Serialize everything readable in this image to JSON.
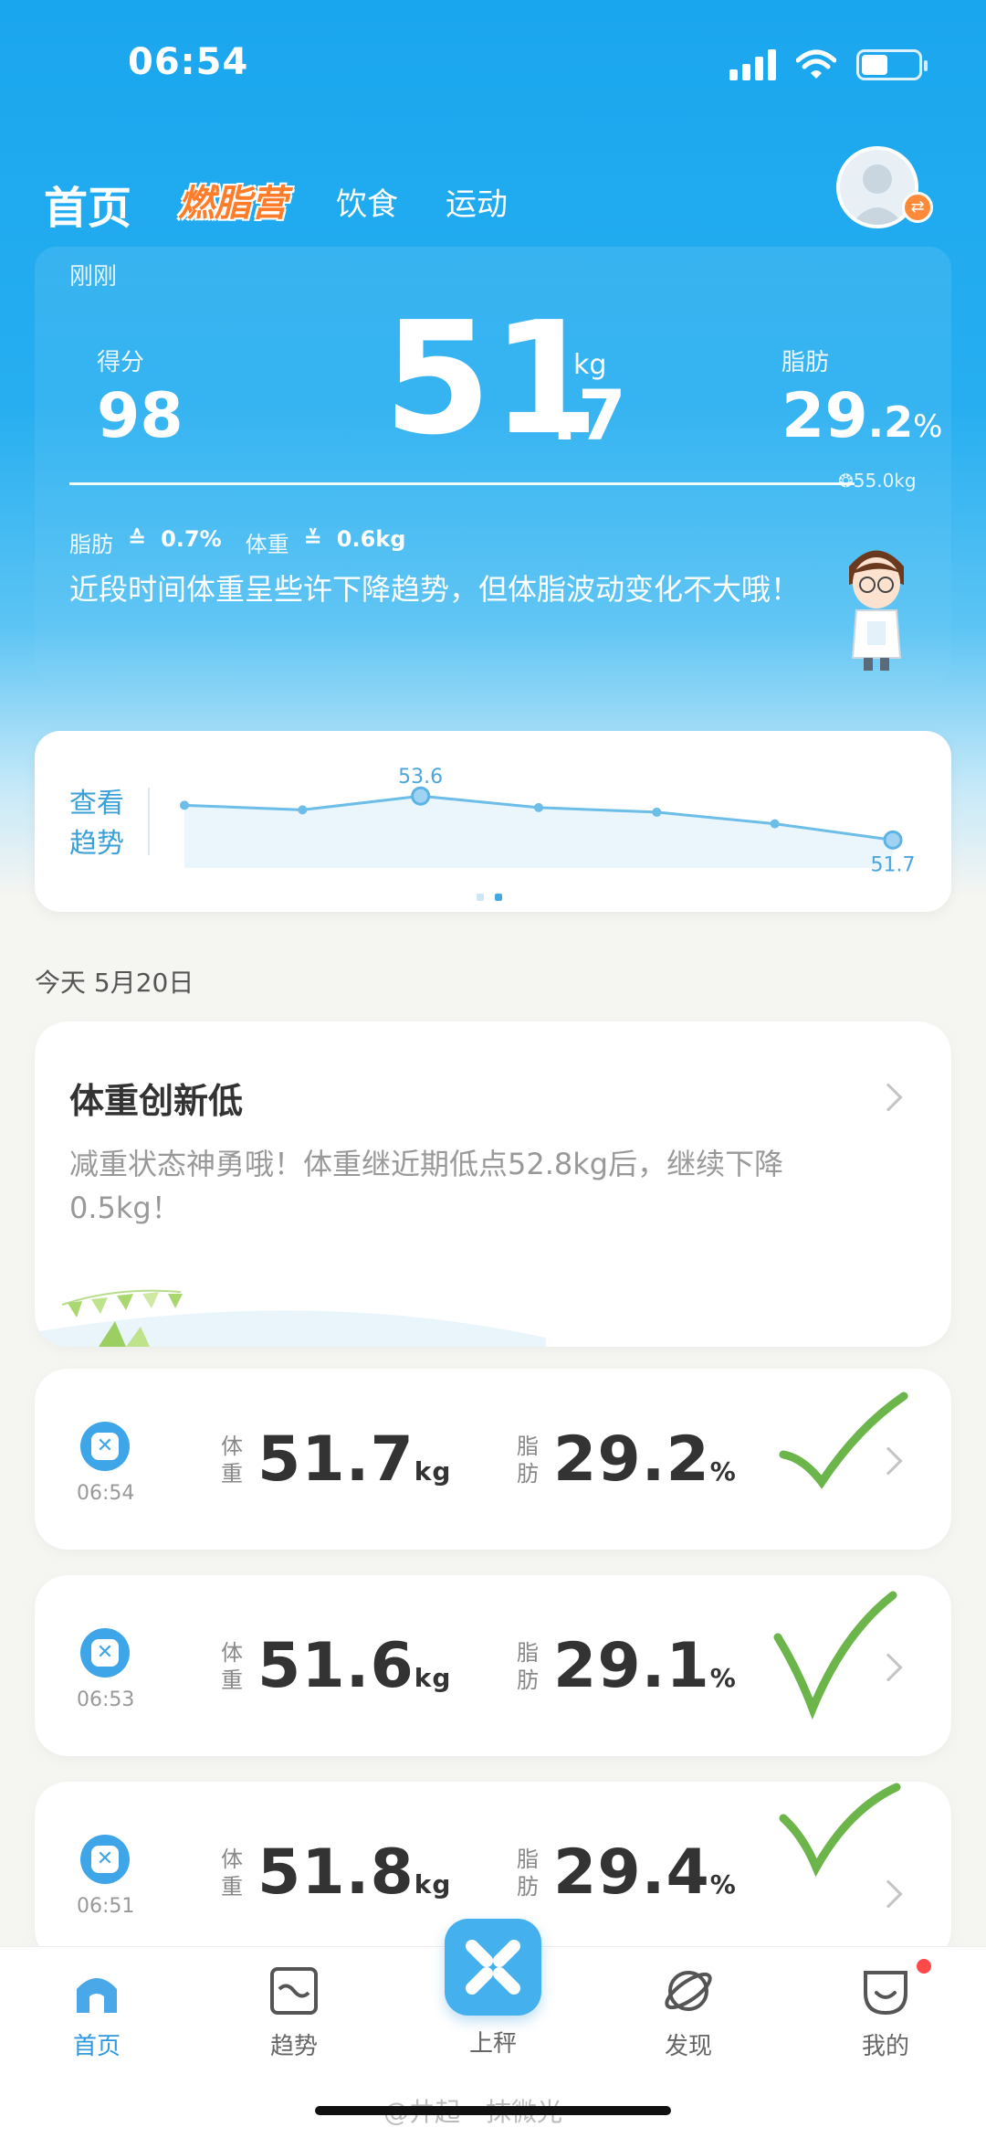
{
  "status_bar": {
    "time": "06:54",
    "icons": [
      "signal-icon",
      "wifi-icon",
      "battery-icon"
    ]
  },
  "header": {
    "tabs": [
      {
        "label": "首页",
        "active": true
      },
      {
        "label": "燃脂营",
        "highlight": "#ff7d2a"
      },
      {
        "label": "饮食"
      },
      {
        "label": "运动"
      }
    ],
    "avatar_icon": "user-avatar-icon",
    "avatar_badge": "⇄"
  },
  "hero": {
    "time_label": "刚刚",
    "score_label": "得分",
    "score_value": "98",
    "weight_int": "51",
    "weight_dec": ".7",
    "weight_unit": "kg",
    "fat_label": "脂肪",
    "fat_int": "29",
    "fat_dec": ".2",
    "fat_unit": "%",
    "goal": "55.0kg",
    "fat_delta_label": "脂肪",
    "fat_delta_value": "0.7%",
    "weight_delta_label": "体重",
    "weight_delta_value": "0.6kg",
    "advice": "近段时间体重呈些许下降趋势，但体脂波动变化不大哦！"
  },
  "trend": {
    "label_line1": "查看",
    "label_line2": "趋势",
    "chart_data": {
      "type": "line",
      "values": [
        53.2,
        53.0,
        53.6,
        53.1,
        52.9,
        52.4,
        51.7
      ],
      "labeled": [
        {
          "index": 2,
          "label": "53.6"
        },
        {
          "index": 6,
          "label": "51.7"
        }
      ]
    },
    "page_dots": 2,
    "active_dot": 1
  },
  "date_line": "今天 5月20日",
  "milestone": {
    "title": "体重创新低",
    "desc": "减重状态神勇哦！体重继近期低点52.8kg后，继续下降0.5kg！"
  },
  "records_labels": {
    "weight_line1": "体",
    "weight_line2": "重",
    "fat_line1": "脂",
    "fat_line2": "肪",
    "weight_unit": "kg",
    "fat_unit": "%"
  },
  "records": [
    {
      "time": "06:54",
      "weight": "51.7",
      "fat": "29.2"
    },
    {
      "time": "06:53",
      "weight": "51.6",
      "fat": "29.1"
    },
    {
      "time": "06:51",
      "weight": "51.8",
      "fat": "29.4"
    }
  ],
  "bottom_nav": {
    "items": [
      {
        "label": "首页",
        "icon": "home-icon",
        "active": true
      },
      {
        "label": "趋势",
        "icon": "trend-icon"
      },
      {
        "label": "上秤",
        "icon": "scale-icon"
      },
      {
        "label": "发现",
        "icon": "planet-icon"
      },
      {
        "label": "我的",
        "icon": "profile-icon",
        "badge": true
      }
    ]
  },
  "watermark": "@井起一抹微光",
  "colors": {
    "primary": "#1aa6ee",
    "accent": "#ff7d2a",
    "check": "#6bb54a",
    "trend_line": "#6cbde8"
  }
}
